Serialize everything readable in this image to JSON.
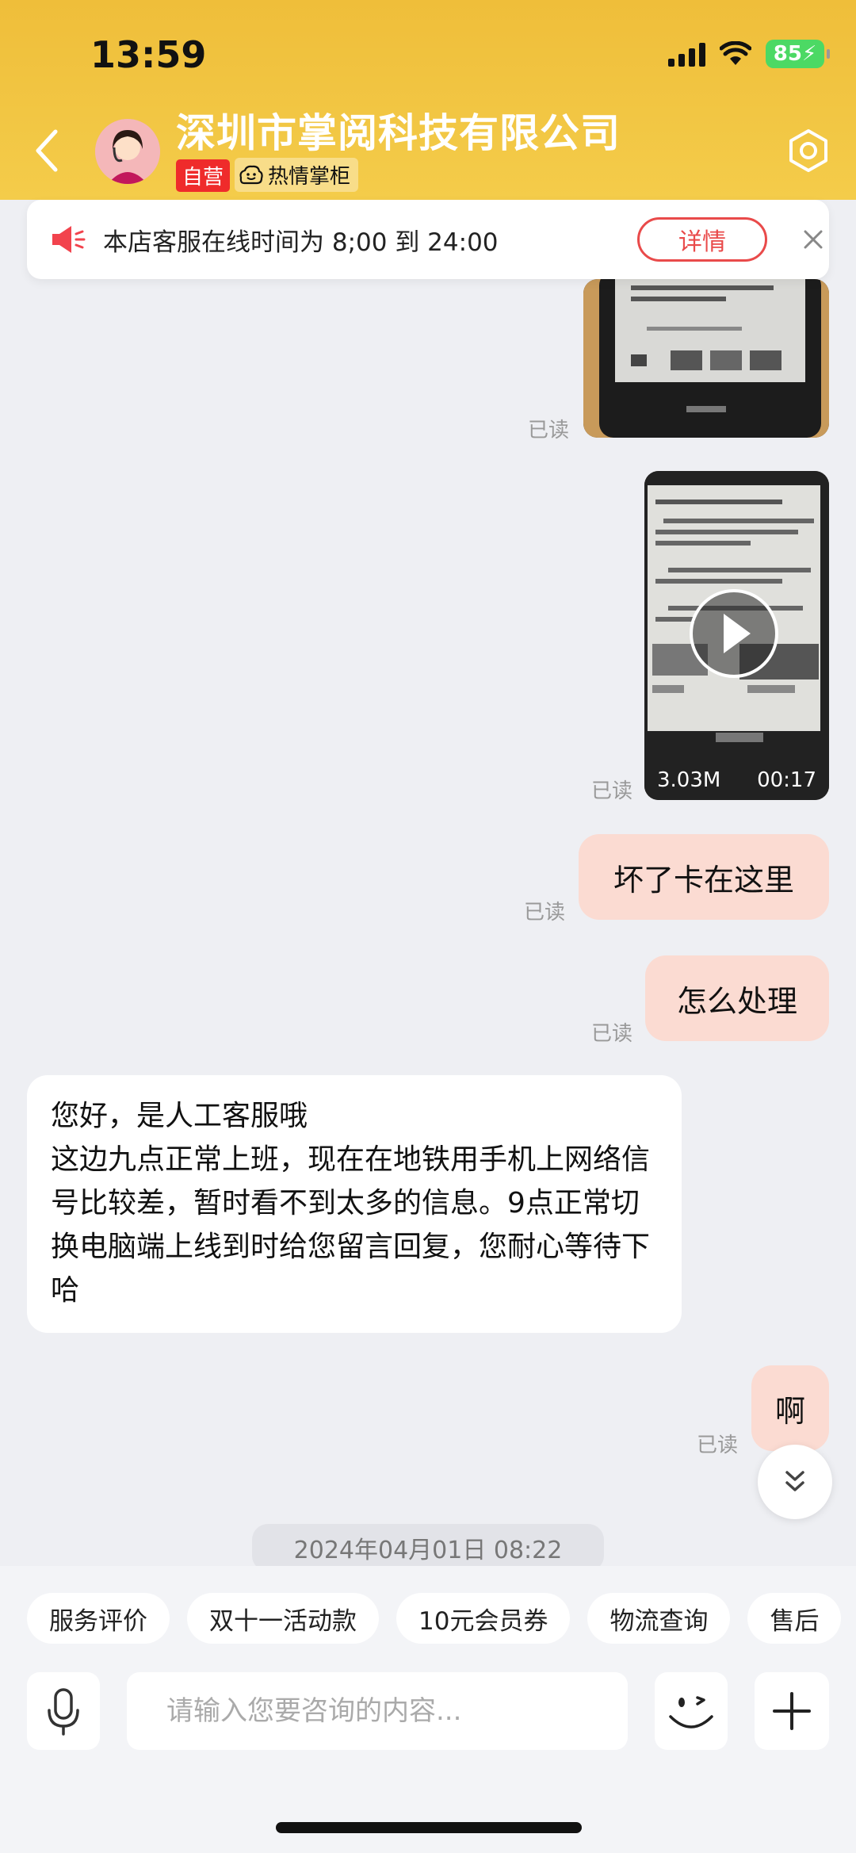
{
  "status_bar": {
    "time": "13:59",
    "battery": "85"
  },
  "header": {
    "shop_name": "深圳市掌阅科技有限公司",
    "tag_self": "自营",
    "tag_hot": "热情掌柜"
  },
  "notice": {
    "text": "本店客服在线时间为 8;00 到 24:00",
    "detail_label": "详情"
  },
  "messages": {
    "read_label": "已读",
    "video": {
      "size": "3.03M",
      "duration": "00:17"
    },
    "out_1": "坏了卡在这里",
    "out_2": "怎么处理",
    "in_1": "您好，是人工客服哦\n这边九点正常上班，现在在地铁用手机上网络信号比较差，暂时看不到太多的信息。9点正常切换电脑端上线到时给您留言回复，您耐心等待下哈",
    "out_3": "啊",
    "timestamp": "2024年04月01日 08:22"
  },
  "quick_chips": [
    "服务评价",
    "双十一活动款",
    "10元会员券",
    "物流查询",
    "售后"
  ],
  "input": {
    "placeholder": "请输入您要咨询的内容..."
  },
  "colors": {
    "header": "#f2c542",
    "bubble_out": "#fbdbd2",
    "accent_red": "#e94a4a",
    "battery": "#4cd964"
  }
}
